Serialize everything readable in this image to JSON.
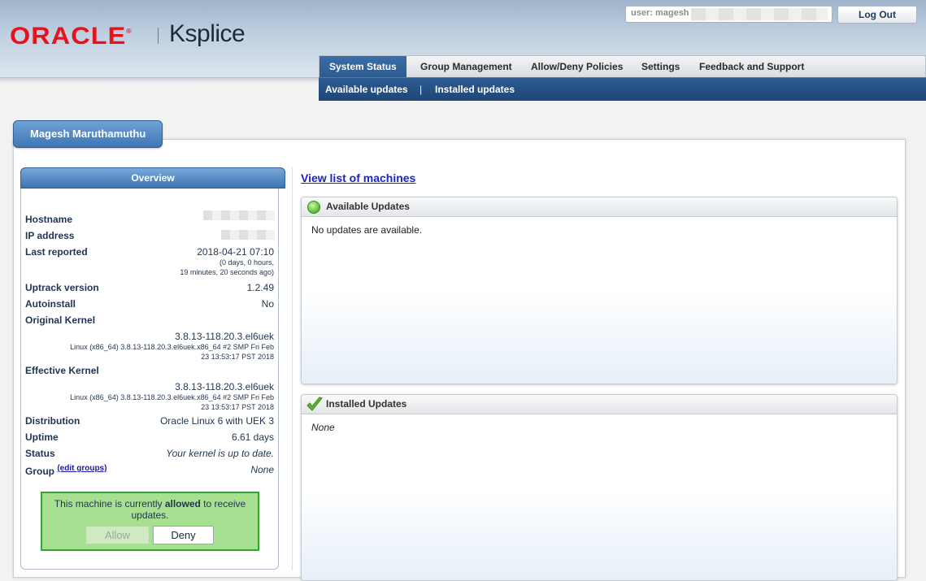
{
  "header": {
    "brand_oracle": "ORACLE",
    "brand_reg": "®",
    "brand_product": "Ksplice",
    "user_label": "user: magesh",
    "logout_label": "Log Out"
  },
  "nav": {
    "tabs": [
      {
        "label": "System Status",
        "active": true
      },
      {
        "label": "Group Management",
        "active": false
      },
      {
        "label": "Allow/Deny Policies",
        "active": false
      },
      {
        "label": "Settings",
        "active": false
      },
      {
        "label": "Feedback and Support",
        "active": false
      }
    ],
    "subnav": [
      {
        "label": "Available updates"
      },
      {
        "label": "Installed updates"
      }
    ],
    "subnav_separator": "|"
  },
  "machine": {
    "name": "Magesh Maruthamuthu"
  },
  "overview": {
    "title": "Overview",
    "hostname_label": "Hostname",
    "ip_label": "IP address",
    "last_reported_label": "Last reported",
    "last_reported_value": "2018-04-21 07:10",
    "last_reported_ago_1": "(0 days, 0 hours,",
    "last_reported_ago_2": "19 minutes, 20 seconds ago)",
    "uptrack_label": "Uptrack version",
    "uptrack_value": "1.2.49",
    "autoinstall_label": "Autoinstall",
    "autoinstall_value": "No",
    "original_kernel_label": "Original Kernel",
    "original_kernel_value": "3.8.13-118.20.3.el6uek",
    "original_kernel_detail_1": "Linux (x86_64) 3.8.13-118.20.3.el6uek.x86_64 #2 SMP Fri Feb",
    "original_kernel_detail_2": "23 13:53:17 PST 2018",
    "effective_kernel_label": "Effective Kernel",
    "effective_kernel_value": "3.8.13-118.20.3.el6uek",
    "effective_kernel_detail_1": "Linux (x86_64) 3.8.13-118.20.3.el6uek.x86_64 #2 SMP Fri Feb",
    "effective_kernel_detail_2": "23 13:53:17 PST 2018",
    "distribution_label": "Distribution",
    "distribution_value": "Oracle Linux 6 with UEK 3",
    "uptime_label": "Uptime",
    "uptime_value": "6.61 days",
    "status_label": "Status",
    "status_value": "Your kernel is up to date.",
    "group_label": "Group",
    "edit_groups_label": "(edit groups)",
    "group_value": "None"
  },
  "policy": {
    "text_before": "This machine is currently ",
    "text_bold": "allowed",
    "text_after": " to receive updates.",
    "allow_label": "Allow",
    "deny_label": "Deny"
  },
  "main": {
    "machines_link": "View list of machines",
    "available_title": "Available Updates",
    "available_body": "No updates are available.",
    "installed_title": "Installed Updates",
    "installed_body": "None"
  },
  "colors": {
    "accent_blue": "#2c5a8e",
    "oracle_red": "#e8121d",
    "allowed_green": "#a6e090"
  }
}
